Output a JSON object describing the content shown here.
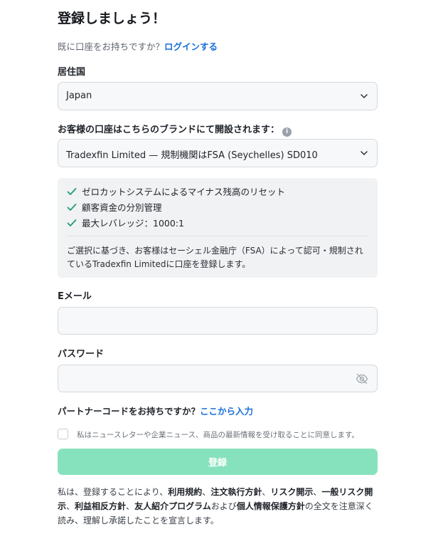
{
  "title": "登録しましょう！",
  "login_prompt": "既に口座をお持ちですか？",
  "login_link": "ログインする",
  "country": {
    "label": "居住国",
    "value": "Japan"
  },
  "brand": {
    "label": "お客様の口座はこちらのブランドにて開設されます：",
    "value": "Tradexfin Limited — 規制機関はFSA (Seychelles) SD010"
  },
  "features": [
    "ゼロカットシステムによるマイナス残高のリセット",
    "顧客資金の分別管理",
    "最大レバレッジ：1000:1"
  ],
  "disclaimer": "ご選択に基づき、お客様はセーシェル金融庁（FSA）によって認可・規制されているTradexfin Limitedに口座を登録します。",
  "email": {
    "label": "Eメール",
    "value": ""
  },
  "password": {
    "label": "パスワード",
    "value": ""
  },
  "partner": {
    "prompt": "パートナーコードをお持ちですか？",
    "link": "ここから入力"
  },
  "newsletter_consent": "私はニュースレターや企業ニュース、商品の最新情報を受け取ることに同意します。",
  "submit_label": "登録",
  "terms": {
    "intro": "私は、登録することにより、",
    "link_terms": "利用規約",
    "sep": "、",
    "link_execution": "注文執行方針",
    "link_risk": "リスク開示",
    "link_general_risk": "一般リスク開示",
    "link_conflict": "利益相反方針",
    "link_referral": "友人紹介プログラム",
    "and": "および",
    "link_privacy": "個人情報保護方針",
    "outro": "の全文を注意深く読み、理解し承諾したことを宣言します。"
  },
  "colors": {
    "link": "#1a6fd8",
    "check": "#1f9d6e",
    "submit_disabled": "#86e2bd"
  }
}
